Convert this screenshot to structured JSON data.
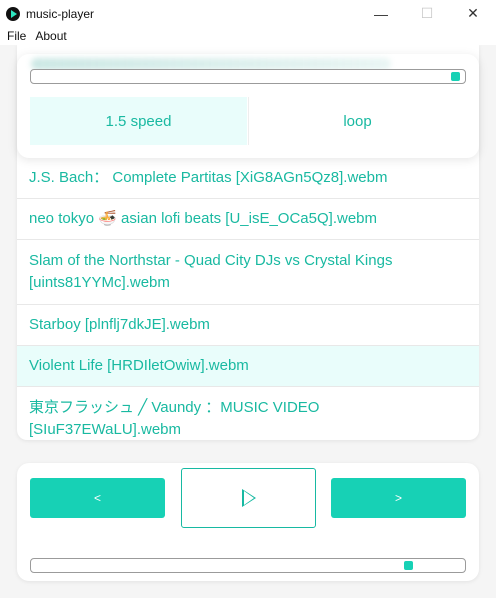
{
  "window": {
    "title": "music-player",
    "controls": {
      "minimize": "—",
      "maximize": "☐",
      "close": "✕"
    }
  },
  "menu": [
    "File",
    "About"
  ],
  "now_playing_panel": {
    "progress_fraction": 0.99,
    "options": {
      "speed_label": "1.5 speed",
      "loop_label": "loop"
    }
  },
  "playlist": [
    {
      "title": "J.S. Bach： Complete Partitas [XiG8AGn5Qz8].webm"
    },
    {
      "title": "neo tokyo 🍜 asian lofi beats [U_isE_OCa5Q].webm"
    },
    {
      "title": "Slam of the Northstar - Quad City DJs vs Crystal Kings [uints81YYMc].webm"
    },
    {
      "title": "Starboy [plnflj7dkJE].webm"
    },
    {
      "title": "Violent Life [HRDIletOwiw].webm",
      "active": true
    },
    {
      "title": "東京フラッシュ ╱ Vaundy ：MUSIC VIDEO [SIuF37EWaLU].webm"
    }
  ],
  "controls": {
    "prev_label": "<",
    "play_icon": "play-icon",
    "next_label": ">"
  },
  "volume_fraction": 0.88,
  "colors": {
    "accent": "#17d1b5",
    "accent_text": "#19b9a1",
    "active_row_bg": "#e9fdfb"
  }
}
